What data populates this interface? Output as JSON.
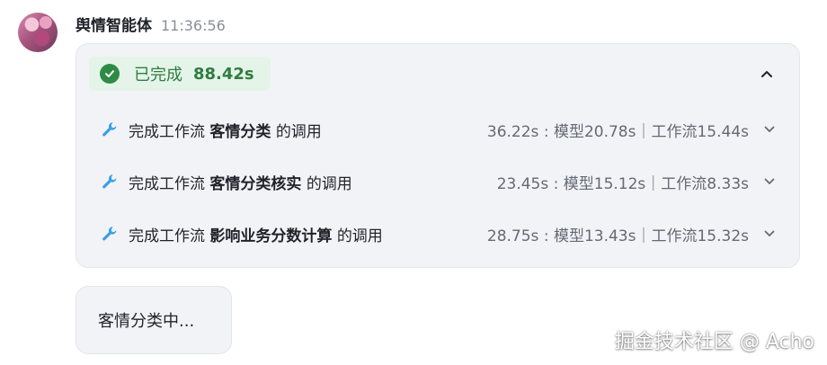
{
  "message": {
    "sender_name": "舆情智能体",
    "time": "11:36:56"
  },
  "status": {
    "label": "已完成",
    "duration": "88.42s",
    "color": "#2e8b45"
  },
  "steps": [
    {
      "prefix": "完成工作流",
      "name": "客情分类",
      "suffix": "的调用",
      "metrics": "36.22s : 模型20.78s｜工作流15.44s"
    },
    {
      "prefix": "完成工作流",
      "name": "客情分类核实",
      "suffix": "的调用",
      "metrics": "23.45s : 模型15.12s｜工作流8.33s"
    },
    {
      "prefix": "完成工作流",
      "name": "影响业务分数计算",
      "suffix": "的调用",
      "metrics": "28.75s : 模型13.43s｜工作流15.32s"
    }
  ],
  "bubble": {
    "text": "客情分类中..."
  },
  "watermark": "掘金技术社区 @ Acho",
  "icons": {
    "avatar": "avatar-image",
    "status": "check-circle-icon",
    "collapse": "chevron-up-icon",
    "step": "wrench-icon",
    "expand": "chevron-down-icon"
  },
  "colors": {
    "accent_blue": "#3aa0e6",
    "success_green": "#2e7d40",
    "card_bg": "#f2f3f7"
  }
}
